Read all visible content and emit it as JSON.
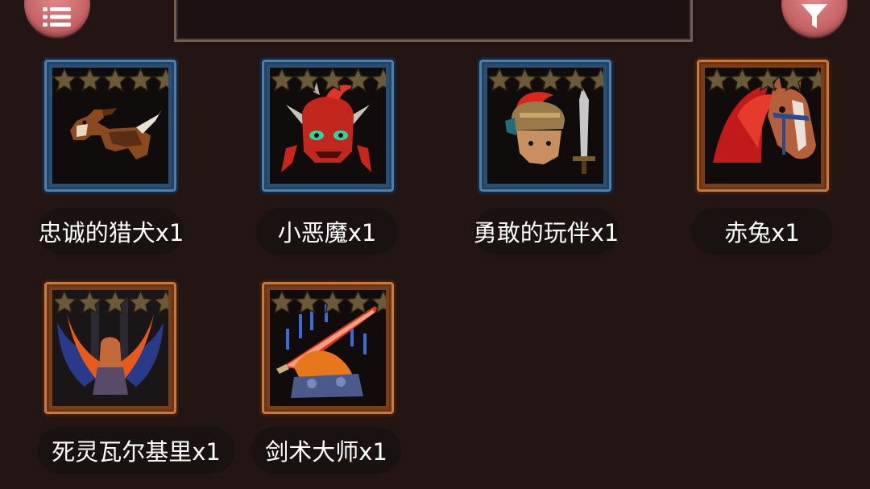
{
  "items": [
    {
      "name": "忠诚的猎犬x1",
      "icon": "loyal-hound-icon",
      "rarity": "blue"
    },
    {
      "name": "小恶魔x1",
      "icon": "little-demon-icon",
      "rarity": "blue"
    },
    {
      "name": "勇敢的玩伴x1",
      "icon": "brave-companion-icon",
      "rarity": "blue"
    },
    {
      "name": "赤兔x1",
      "icon": "red-hare-horse-icon",
      "rarity": "orange"
    },
    {
      "name": "死灵瓦尔基里x1",
      "icon": "necro-valkyrie-icon",
      "rarity": "orange"
    },
    {
      "name": "剑术大师x1",
      "icon": "sword-master-icon",
      "rarity": "orange"
    }
  ],
  "star_count": 5,
  "buttons": {
    "menu": "list-menu-icon",
    "filter": "filter-funnel-icon"
  },
  "colors": {
    "blue_frame": "#2b4f73",
    "orange_frame": "#7a3e19",
    "star": "#6a5a3a",
    "button": "#c56466"
  }
}
